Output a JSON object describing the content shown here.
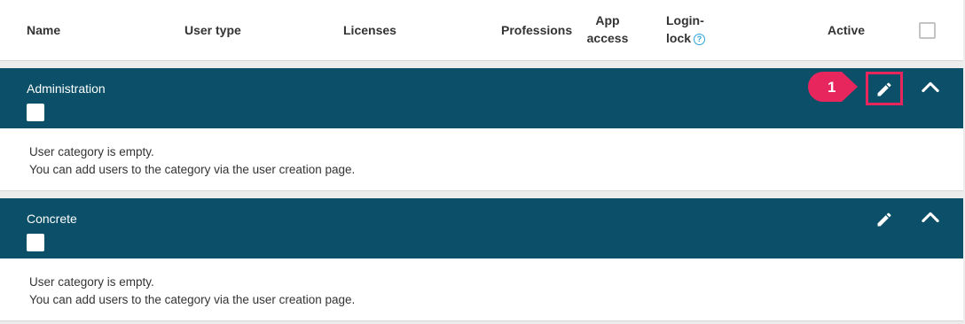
{
  "header": {
    "name": "Name",
    "user_type": "User type",
    "licenses": "Licenses",
    "professions": "Professions",
    "app_access_1": "App",
    "app_access_2": "access",
    "login_lock_1": "Login-",
    "login_lock_2": "lock",
    "help_icon": "?",
    "active": "Active"
  },
  "categories": [
    {
      "title": "Administration",
      "empty_line1": "User category is empty.",
      "empty_line2": "You can add users to the category via the user creation page."
    },
    {
      "title": "Concrete",
      "empty_line1": "User category is empty.",
      "empty_line2": "You can add users to the category via the user creation page."
    }
  ],
  "annotation": {
    "step_number": "1"
  },
  "colors": {
    "category_bar": "#0b4f68",
    "highlight": "#e8265e",
    "help_icon": "#2aa3d8"
  },
  "icons": [
    "pencil-icon",
    "chevron-up-icon",
    "help-icon"
  ]
}
